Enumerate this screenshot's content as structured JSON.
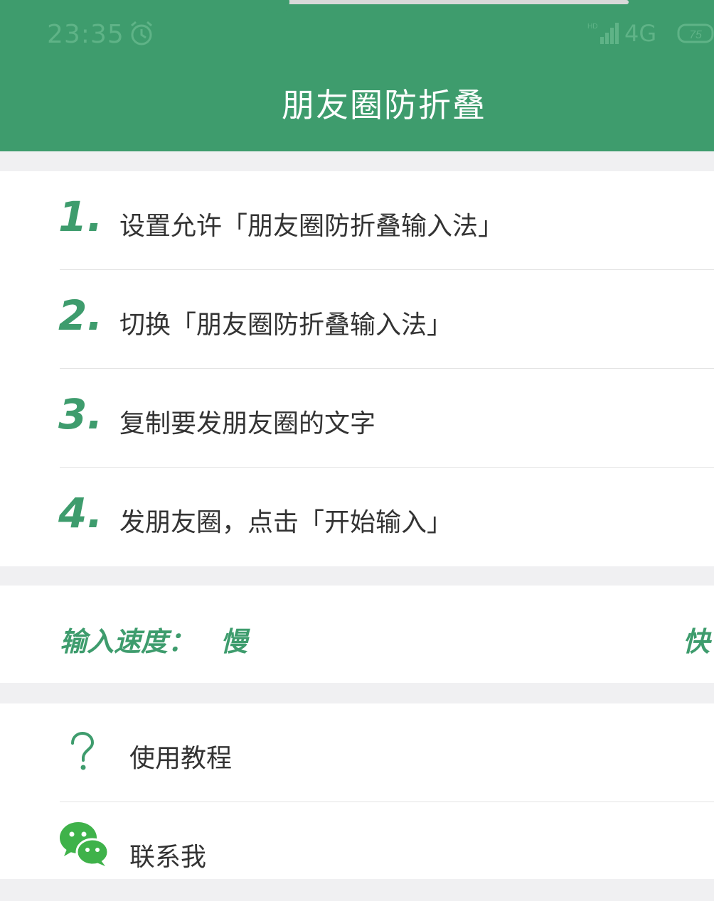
{
  "status_bar": {
    "time": "23:35",
    "network": "4G",
    "battery": "75",
    "icons": [
      "alarm-icon",
      "signal-icon",
      "battery-icon"
    ]
  },
  "header": {
    "title": "朋友圈防折叠"
  },
  "steps": [
    {
      "number": "1.",
      "text": "设置允许「朋友圈防折叠输入法」"
    },
    {
      "number": "2.",
      "text": "切换「朋友圈防折叠输入法」"
    },
    {
      "number": "3.",
      "text": "复制要发朋友圈的文字"
    },
    {
      "number": "4.",
      "text": "发朋友圈，点击「开始输入」"
    }
  ],
  "speed": {
    "label": "输入速度：",
    "slow_label": "慢",
    "fast_label": "快",
    "value_fraction": 0.0
  },
  "links": [
    {
      "icon": "question-icon",
      "label": "使用教程"
    },
    {
      "icon": "wechat-icon",
      "label": "联系我"
    }
  ],
  "colors": {
    "brand": "#3e9c6d",
    "background": "#f0f0f2",
    "card": "#ffffff",
    "text": "#333333",
    "track": "#d9d9d9"
  }
}
